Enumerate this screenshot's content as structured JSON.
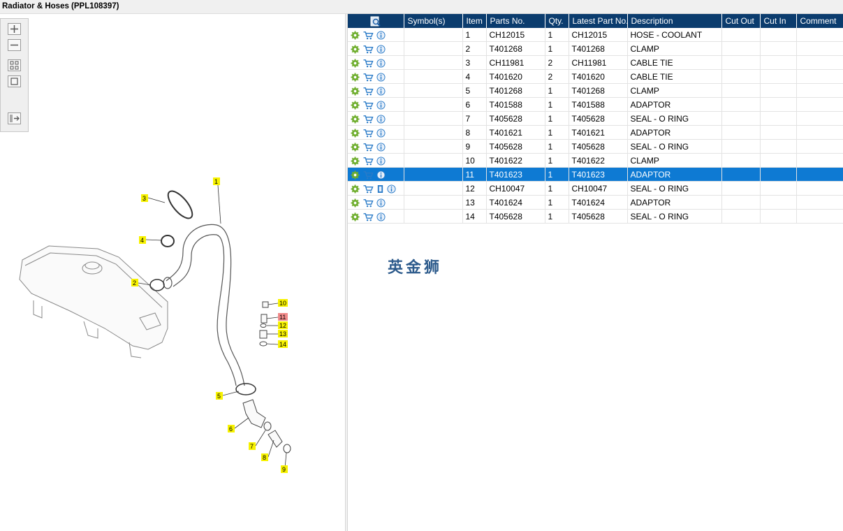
{
  "window": {
    "title": "Radiator & Hoses (PPL108397)"
  },
  "toolbox": {
    "zoom_in_icon": "plus-icon",
    "zoom_out_icon": "minus-icon",
    "fit_icon": "grid-icon",
    "reset_icon": "square-icon",
    "split_icon": "layout-arrow-icon"
  },
  "table": {
    "headers": [
      "",
      "Symbol(s)",
      "Item",
      "Parts No.",
      "Qty.",
      "Latest Part No.",
      "Description",
      "Cut Out",
      "Cut In",
      "Comment"
    ],
    "selected_item": "11",
    "rows": [
      {
        "item": "1",
        "part": "CH12015",
        "qty": "1",
        "latest": "CH12015",
        "desc": "HOSE - COOLANT"
      },
      {
        "item": "2",
        "part": "T401268",
        "qty": "1",
        "latest": "T401268",
        "desc": "CLAMP"
      },
      {
        "item": "3",
        "part": "CH11981",
        "qty": "2",
        "latest": "CH11981",
        "desc": "CABLE TIE"
      },
      {
        "item": "4",
        "part": "T401620",
        "qty": "2",
        "latest": "T401620",
        "desc": "CABLE TIE"
      },
      {
        "item": "5",
        "part": "T401268",
        "qty": "1",
        "latest": "T401268",
        "desc": "CLAMP"
      },
      {
        "item": "6",
        "part": "T401588",
        "qty": "1",
        "latest": "T401588",
        "desc": "ADAPTOR"
      },
      {
        "item": "7",
        "part": "T405628",
        "qty": "1",
        "latest": "T405628",
        "desc": "SEAL - O RING"
      },
      {
        "item": "8",
        "part": "T401621",
        "qty": "1",
        "latest": "T401621",
        "desc": "ADAPTOR"
      },
      {
        "item": "9",
        "part": "T405628",
        "qty": "1",
        "latest": "T405628",
        "desc": "SEAL - O RING"
      },
      {
        "item": "10",
        "part": "T401622",
        "qty": "1",
        "latest": "T401622",
        "desc": "CLAMP"
      },
      {
        "item": "11",
        "part": "T401623",
        "qty": "1",
        "latest": "T401623",
        "desc": "ADAPTOR"
      },
      {
        "item": "12",
        "part": "CH10047",
        "qty": "1",
        "latest": "CH10047",
        "desc": "SEAL - O RING",
        "doc": true
      },
      {
        "item": "13",
        "part": "T401624",
        "qty": "1",
        "latest": "T401624",
        "desc": "ADAPTOR"
      },
      {
        "item": "14",
        "part": "T405628",
        "qty": "1",
        "latest": "T405628",
        "desc": "SEAL - O RING"
      }
    ]
  },
  "watermark": "英金狮",
  "callouts": [
    "1",
    "2",
    "3",
    "4",
    "5",
    "6",
    "7",
    "8",
    "9",
    "10",
    "11",
    "12",
    "13",
    "14"
  ],
  "colors": {
    "header_bg": "#0b3c6e",
    "selected_row": "#0e7ad3",
    "callout": "#f7f200",
    "callout_selected": "#f08a8a"
  }
}
